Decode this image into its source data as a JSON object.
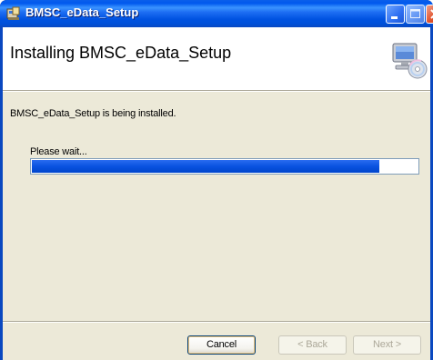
{
  "window": {
    "title": "BMSC_eData_Setup",
    "icon": "installer-icon"
  },
  "titlebar_buttons": [
    "minimize-icon",
    "maximize-icon",
    "close-icon"
  ],
  "header": {
    "title": "Installing BMSC_eData_Setup",
    "icon": "computer-cd-icon"
  },
  "body": {
    "status_text": "BMSC_eData_Setup is being installed.",
    "wait_text": "Please wait...",
    "progress_percent": 90
  },
  "footer": {
    "cancel_label": "Cancel",
    "back_label": "< Back",
    "next_label": "Next >"
  },
  "colors": {
    "titlebar": "#0058ee",
    "progress_fill": "#0a52e0",
    "client_bg": "#ece9d8"
  }
}
